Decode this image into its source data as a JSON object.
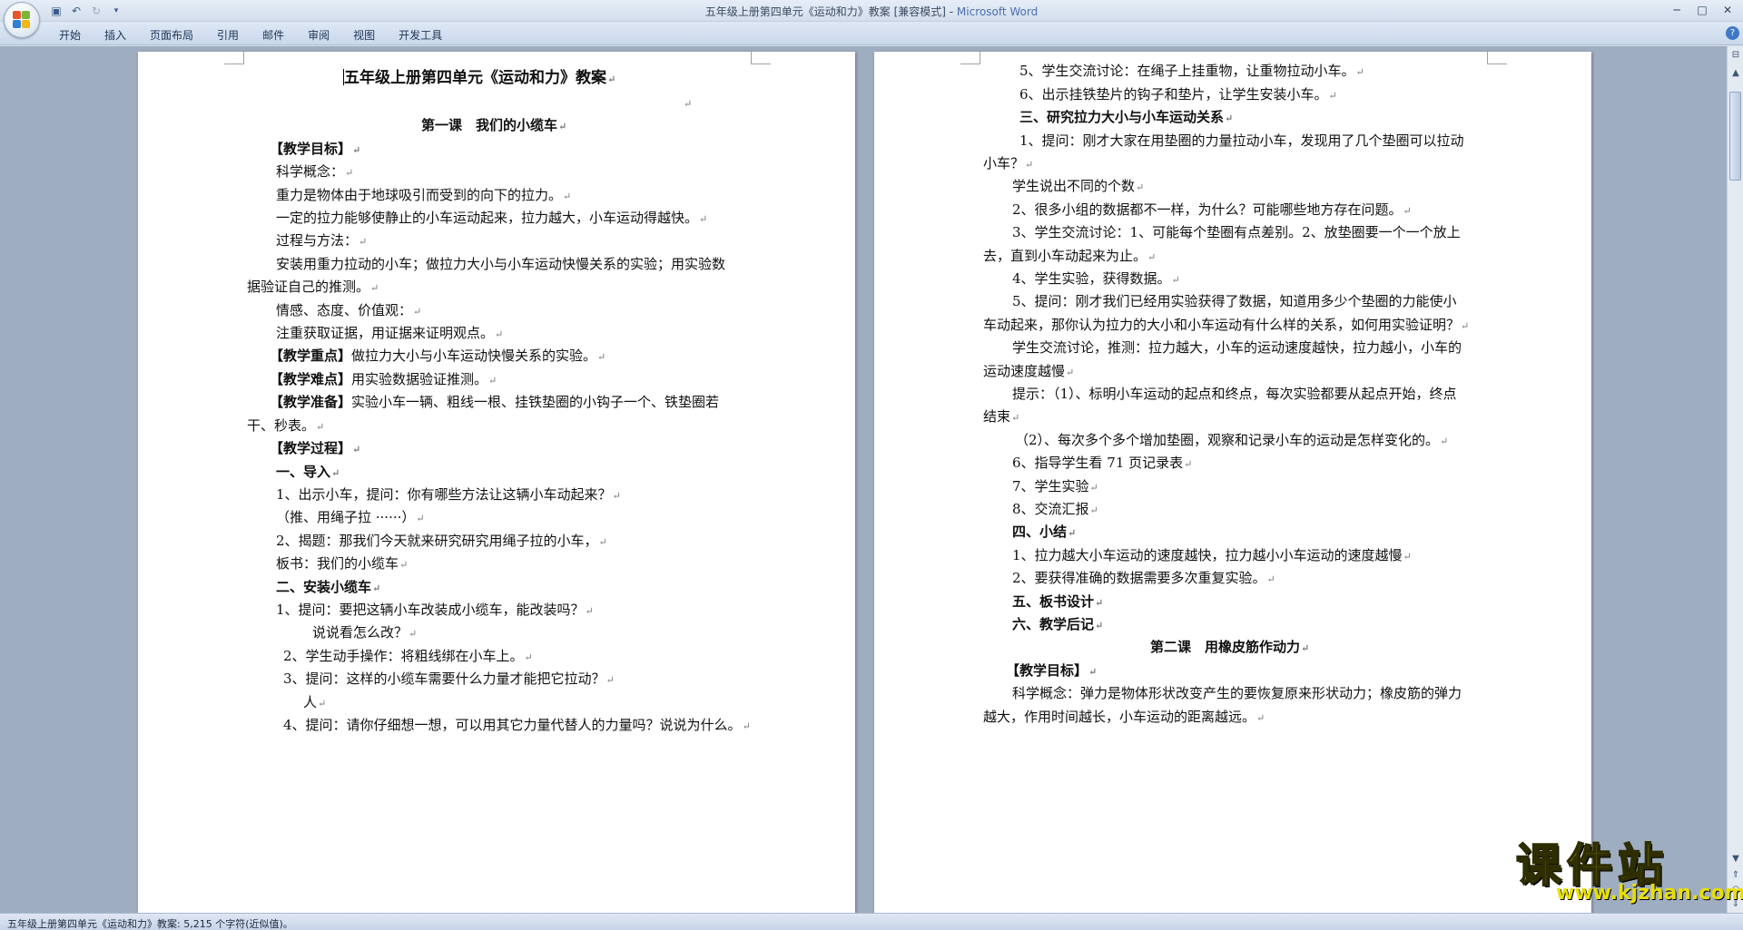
{
  "window": {
    "doc_title": "五年级上册第四单元《运动和力》教案 [兼容模式] - ",
    "app_name": "Microsoft Word",
    "controls": {
      "minimize": "─",
      "maximize": "□",
      "close": "✕"
    }
  },
  "qat": {
    "save_icon": "save-icon",
    "undo_icon": "undo-icon",
    "redo_icon": "redo-icon",
    "customize_icon": "dropdown-icon"
  },
  "ribbon": {
    "tabs": [
      "开始",
      "插入",
      "页面布局",
      "引用",
      "邮件",
      "审阅",
      "视图",
      "开发工具"
    ],
    "help": "?"
  },
  "status": {
    "text": "五年级上册第四单元《运动和力》教案: 5,215 个字符(近似值)。"
  },
  "watermark": {
    "text": "课件站",
    "url": "www.kjzhan.com"
  },
  "colors": {
    "ribbon_bg": "#dfe8f5",
    "workspace_bg": "#9fadc0",
    "watermark": "#d8d400"
  },
  "page1": {
    "title": "五年级上册第四单元《运动和力》教案",
    "lesson_title": "第一课　我们的小缆车",
    "lines": [
      "【教学目标】",
      "科学概念：",
      "重力是物体由于地球吸引而受到的向下的拉力。",
      "一定的拉力能够使静止的小车运动起来，拉力越大，小车运动得越快。",
      "过程与方法：",
      "安装用重力拉动的小车；做拉力大小与小车运动快慢关系的实验；用实验数",
      "据验证自己的推测。",
      "情感、态度、价值观：",
      "注重获取证据，用证据来证明观点。",
      "【教学重点】",
      "做拉力大小与小车运动快慢关系的实验。",
      "【教学难点】",
      "用实验数据验证推测。",
      "【教学准备】",
      "实验小车一辆、粗线一根、挂铁垫圈的小钩子一个、铁垫圈若",
      "干、秒表。",
      "【教学过程】",
      "一、导入",
      "1、出示小车，提问：你有哪些方法让这辆小车动起来？",
      "（推、用绳子拉 ······）",
      "2、揭题：那我们今天就来研究研究用绳子拉的小车，",
      "板书：我们的小缆车",
      "二、安装小缆车",
      "1、提问：要把这辆小车改装成小缆车，能改装吗？",
      "说说看怎么改？",
      "2、学生动手操作：将粗线绑在小车上。",
      "3、提问：这样的小缆车需要什么力量才能把它拉动？",
      "人",
      "4、提问：请你仔细想一想，可以用其它力量代替人的力量吗？说说为什么。"
    ]
  },
  "page2": {
    "lines": [
      "5、学生交流讨论：在绳子上挂重物，让重物拉动小车。",
      "6、出示挂铁垫片的钩子和垫片，让学生安装小车。",
      "三、研究拉力大小与小车运动关系",
      "1、提问：刚才大家在用垫圈的力量拉动小车，发现用了几个垫圈可以拉动",
      "小车？",
      "学生说出不同的个数",
      "2、很多小组的数据都不一样，为什么？可能哪些地方存在问题。",
      "3、学生交流讨论：1、可能每个垫圈有点差别。2、放垫圈要一个一个放上",
      "去，直到小车动起来为止。",
      "4、学生实验，获得数据。",
      "5、提问：刚才我们已经用实验获得了数据，知道用多少个垫圈的力能使小",
      "车动起来，那你认为拉力的大小和小车运动有什么样的关系，如何用实验证明？",
      "学生交流讨论，推测：拉力越大，小车的运动速度越快，拉力越小，小车的",
      "运动速度越慢",
      "提示：（1）、标明小车运动的起点和终点，每次实验都要从起点开始，终点",
      "结束",
      "（2）、每次多个多个增加垫圈，观察和记录小车的运动是怎样变化的。",
      "6、指导学生看 71 页记录表",
      "7、学生实验",
      "8、交流汇报",
      "四、小结",
      "1、拉力越大小车运动的速度越快，拉力越小小车运动的速度越慢",
      "2、要获得准确的数据需要多次重复实验。",
      "五、板书设计",
      "六、教学后记",
      "第二课　用橡皮筋作动力",
      "【教学目标】",
      "科学概念：弹力是物体形状改变产生的要恢复原来形状动力；橡皮筋的弹力",
      "越大，作用时间越长，小车运动的距离越远。"
    ]
  }
}
